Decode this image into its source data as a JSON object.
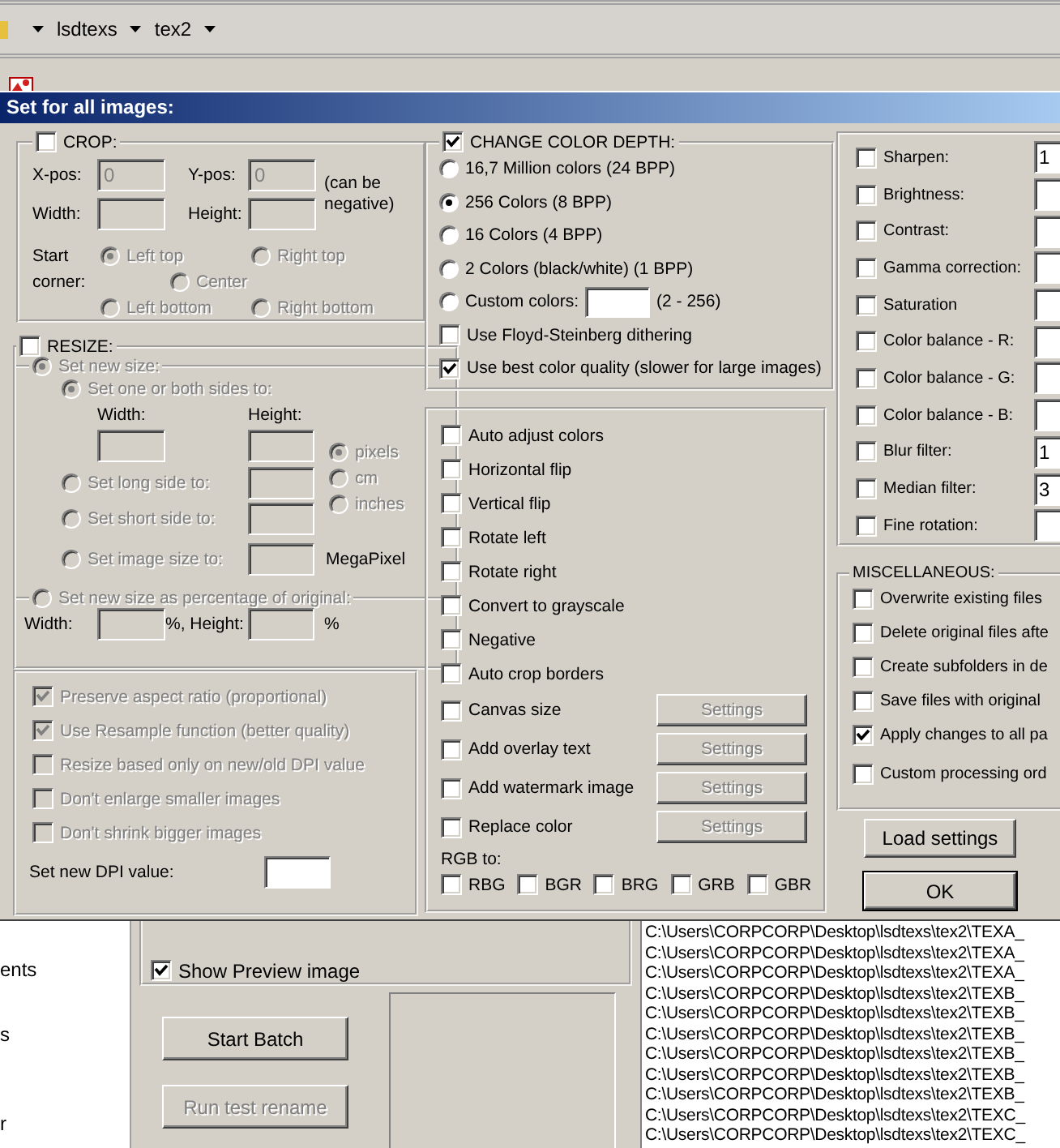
{
  "explorer": {
    "breadcrumbs": [
      {
        "label": "lsdtexs"
      },
      {
        "label": "tex2"
      }
    ],
    "nav_items": [
      "ents",
      "s",
      "r"
    ]
  },
  "batch_window": {
    "options": [
      {
        "label": "Show Preview image",
        "checked": true
      }
    ],
    "buttons": [
      {
        "label": "Start Batch",
        "disabled": false
      },
      {
        "label": "Run test rename",
        "disabled": true
      }
    ],
    "file_list": [
      "C:\\Users\\CORPCORP\\Desktop\\lsdtexs\\tex2\\TEXA_",
      "C:\\Users\\CORPCORP\\Desktop\\lsdtexs\\tex2\\TEXA_",
      "C:\\Users\\CORPCORP\\Desktop\\lsdtexs\\tex2\\TEXA_",
      "C:\\Users\\CORPCORP\\Desktop\\lsdtexs\\tex2\\TEXB_",
      "C:\\Users\\CORPCORP\\Desktop\\lsdtexs\\tex2\\TEXB_",
      "C:\\Users\\CORPCORP\\Desktop\\lsdtexs\\tex2\\TEXB_",
      "C:\\Users\\CORPCORP\\Desktop\\lsdtexs\\tex2\\TEXB_",
      "C:\\Users\\CORPCORP\\Desktop\\lsdtexs\\tex2\\TEXB_",
      "C:\\Users\\CORPCORP\\Desktop\\lsdtexs\\tex2\\TEXB_",
      "C:\\Users\\CORPCORP\\Desktop\\lsdtexs\\tex2\\TEXC_",
      "C:\\Users\\CORPCORP\\Desktop\\lsdtexs\\tex2\\TEXC_"
    ]
  },
  "dialog": {
    "title": "Set for all images:",
    "crop": {
      "label": "CROP:",
      "checked": false,
      "fields": [
        {
          "label": "X-pos:",
          "value": "0"
        },
        {
          "label": "Y-pos:",
          "value": "0"
        },
        {
          "label": "Width:"
        },
        {
          "label": "Height:"
        }
      ],
      "note": "(can be negative)",
      "corner_label": "Start corner:",
      "corners": [
        {
          "label": "Left top",
          "selected": true
        },
        {
          "label": "Right top",
          "selected": false
        },
        {
          "label": "Center",
          "selected": false
        },
        {
          "label": "Left bottom",
          "selected": false
        },
        {
          "label": "Right bottom",
          "selected": false
        }
      ]
    },
    "resize": {
      "label": "RESIZE:",
      "checked": false,
      "modes": [
        {
          "label": "Set new size:",
          "selected": true
        },
        {
          "label": "Set new size as percentage of original:",
          "selected": false
        }
      ],
      "width_label": "Width:",
      "height_label": "Height:",
      "sides": [
        {
          "label": "Set one or both sides to:",
          "selected": true
        },
        {
          "label": "Set long side to:",
          "selected": false
        },
        {
          "label": "Set short side to:",
          "selected": false
        },
        {
          "label": "Set image size to:",
          "selected": false,
          "unit": "MegaPixel"
        }
      ],
      "units": [
        {
          "label": "pixels",
          "selected": true
        },
        {
          "label": "cm",
          "selected": false
        },
        {
          "label": "inches",
          "selected": false
        }
      ],
      "percent": {
        "width_label": "Width:",
        "height_label": "%, Height:",
        "unit": "%"
      },
      "options": [
        {
          "label": "Preserve aspect ratio (proportional)",
          "checked": true
        },
        {
          "label": "Use Resample function (better quality)",
          "checked": true
        },
        {
          "label": "Resize based only on new/old DPI value",
          "checked": false
        },
        {
          "label": "Don't enlarge smaller images",
          "checked": false
        },
        {
          "label": "Don't shrink bigger images",
          "checked": false
        }
      ],
      "dpi_label": "Set new DPI value:"
    },
    "color_depth": {
      "label": "CHANGE COLOR DEPTH:",
      "checked": true,
      "modes": [
        {
          "label": "16,7 Million colors (24 BPP)",
          "selected": false,
          "kind": "plain"
        },
        {
          "label": "256 Colors (8 BPP)",
          "selected": true,
          "kind": "plain"
        },
        {
          "label": "16 Colors (4 BPP)",
          "selected": false,
          "kind": "plain"
        },
        {
          "label": "2 Colors (black/white) (1 BPP)",
          "selected": false,
          "kind": "plain"
        },
        {
          "label": "Custom colors:",
          "selected": false,
          "kind": "field",
          "range": "(2 - 256)"
        }
      ],
      "options": [
        {
          "label": "Use Floyd-Steinberg dithering",
          "checked": false
        },
        {
          "label": "Use best color quality (slower for large images)",
          "checked": true
        }
      ]
    },
    "effects": [
      {
        "label": "Auto adjust colors",
        "checked": false,
        "kind": "plain"
      },
      {
        "label": "Horizontal flip",
        "checked": false,
        "kind": "plain"
      },
      {
        "label": "Vertical flip",
        "checked": false,
        "kind": "plain"
      },
      {
        "label": "Rotate left",
        "checked": false,
        "kind": "plain"
      },
      {
        "label": "Rotate right",
        "checked": false,
        "kind": "plain"
      },
      {
        "label": "Convert to grayscale",
        "checked": false,
        "kind": "plain"
      },
      {
        "label": "Negative",
        "checked": false,
        "kind": "plain"
      },
      {
        "label": "Auto crop borders",
        "checked": false,
        "kind": "plain"
      },
      {
        "label": "Canvas size",
        "checked": false,
        "kind": "settings",
        "button": "Settings"
      },
      {
        "label": "Add overlay text",
        "checked": false,
        "kind": "settings",
        "button": "Settings"
      },
      {
        "label": "Add watermark image",
        "checked": false,
        "kind": "settings",
        "button": "Settings"
      },
      {
        "label": "Replace color",
        "checked": false,
        "kind": "settings",
        "button": "Settings"
      }
    ],
    "rgb_label": "RGB to:",
    "rgb": [
      {
        "label": "RBG",
        "checked": false
      },
      {
        "label": "BGR",
        "checked": false
      },
      {
        "label": "BRG",
        "checked": false
      },
      {
        "label": "GRB",
        "checked": false
      },
      {
        "label": "GBR",
        "checked": false
      }
    ],
    "filters": [
      {
        "label": "Sharpen:",
        "checked": false,
        "value": "1"
      },
      {
        "label": "Brightness:",
        "checked": false
      },
      {
        "label": "Contrast:",
        "checked": false
      },
      {
        "label": "Gamma correction:",
        "checked": false
      },
      {
        "label": "Saturation",
        "checked": false
      },
      {
        "label": "Color balance - R:",
        "checked": false
      },
      {
        "label": "Color balance - G:",
        "checked": false
      },
      {
        "label": "Color balance - B:",
        "checked": false
      },
      {
        "label": "Blur filter:",
        "checked": false,
        "value": "1"
      },
      {
        "label": "Median filter:",
        "checked": false,
        "value": "3"
      },
      {
        "label": "Fine rotation:",
        "checked": false
      }
    ],
    "misc": {
      "label": "MISCELLANEOUS:",
      "options": [
        {
          "label": "Overwrite existing files",
          "checked": false
        },
        {
          "label": "Delete original files afte",
          "checked": false
        },
        {
          "label": "Create subfolders in de",
          "checked": false
        },
        {
          "label": "Save files with original",
          "checked": false
        },
        {
          "label": "Apply changes to all pa",
          "checked": true
        },
        {
          "label": "Custom processing ord",
          "checked": false
        }
      ]
    },
    "buttons": [
      {
        "label": "Load settings",
        "default": false
      },
      {
        "label": "OK",
        "default": true
      }
    ]
  }
}
